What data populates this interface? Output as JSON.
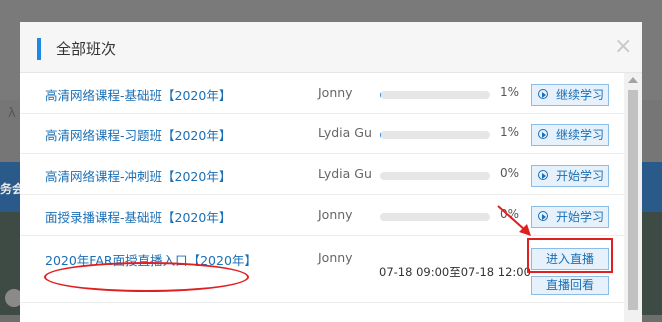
{
  "backdrop": {
    "text1": "λ",
    "text2": "务会"
  },
  "modal": {
    "title": "全部班次",
    "close_glyph": "×"
  },
  "rows": [
    {
      "course": "高清网络课程-基础班【2020年】",
      "teacher": "Jonny",
      "progress": 0.01,
      "percent": "1%",
      "button": "继续学习"
    },
    {
      "course": "高清网络课程-习题班【2020年】",
      "teacher": "Lydia Gu",
      "progress": 0.01,
      "percent": "1%",
      "button": "继续学习"
    },
    {
      "course": "高清网络课程-冲刺班【2020年】",
      "teacher": "Lydia Gu",
      "progress": 0,
      "percent": "0%",
      "button": "开始学习"
    },
    {
      "course": "面授录播课程-基础班【2020年】",
      "teacher": "Jonny",
      "progress": 0,
      "percent": "0%",
      "button": "开始学习"
    }
  ],
  "live_row": {
    "course": "2020年FAR面授直播入口【2020年】",
    "teacher": "Jonny",
    "time": "07-18 09:00至07-18 12:00",
    "enter_button": "进入直播",
    "replay_button": "直播回看"
  },
  "colors": {
    "accent": "#1e88e5",
    "link": "#1a6fb5",
    "annotation": "#e02020"
  }
}
